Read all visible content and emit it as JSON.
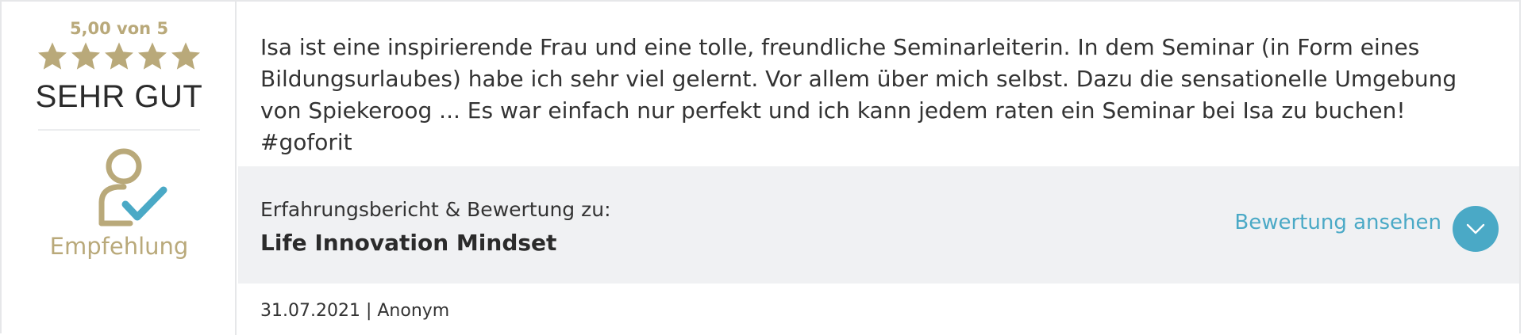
{
  "rating": {
    "score_text": "5,00 von 5",
    "stars": 5,
    "max_stars": 5,
    "label": "SEHR GUT",
    "recommendation_label": "Empfehlung"
  },
  "review": {
    "text": "Isa ist eine inspirierende Frau und eine tolle, freundliche Seminarleiterin. In dem Seminar (in Form eines Bildungsurlaubes) habe ich sehr viel gelernt. Vor allem über mich selbst. Dazu die sensationelle Umgebung von Spiekeroog ... Es war einfach nur perfekt und ich kann jedem raten ein Seminar bei Isa zu buchen! #goforit",
    "caption": "Erfahrungsbericht & Bewertung zu:",
    "product": "Life Innovation Mindset",
    "view_label": "Bewertung ansehen",
    "date": "31.07.2021",
    "author": "Anonym",
    "footer": "31.07.2021 | Anonym"
  },
  "colors": {
    "gold": "#b9a97a",
    "accent": "#4aa9c6",
    "panel": "#f0f1f3"
  },
  "icons": {
    "star": "star-icon",
    "recommendation": "person-check-icon",
    "expand": "chevron-down-icon"
  }
}
